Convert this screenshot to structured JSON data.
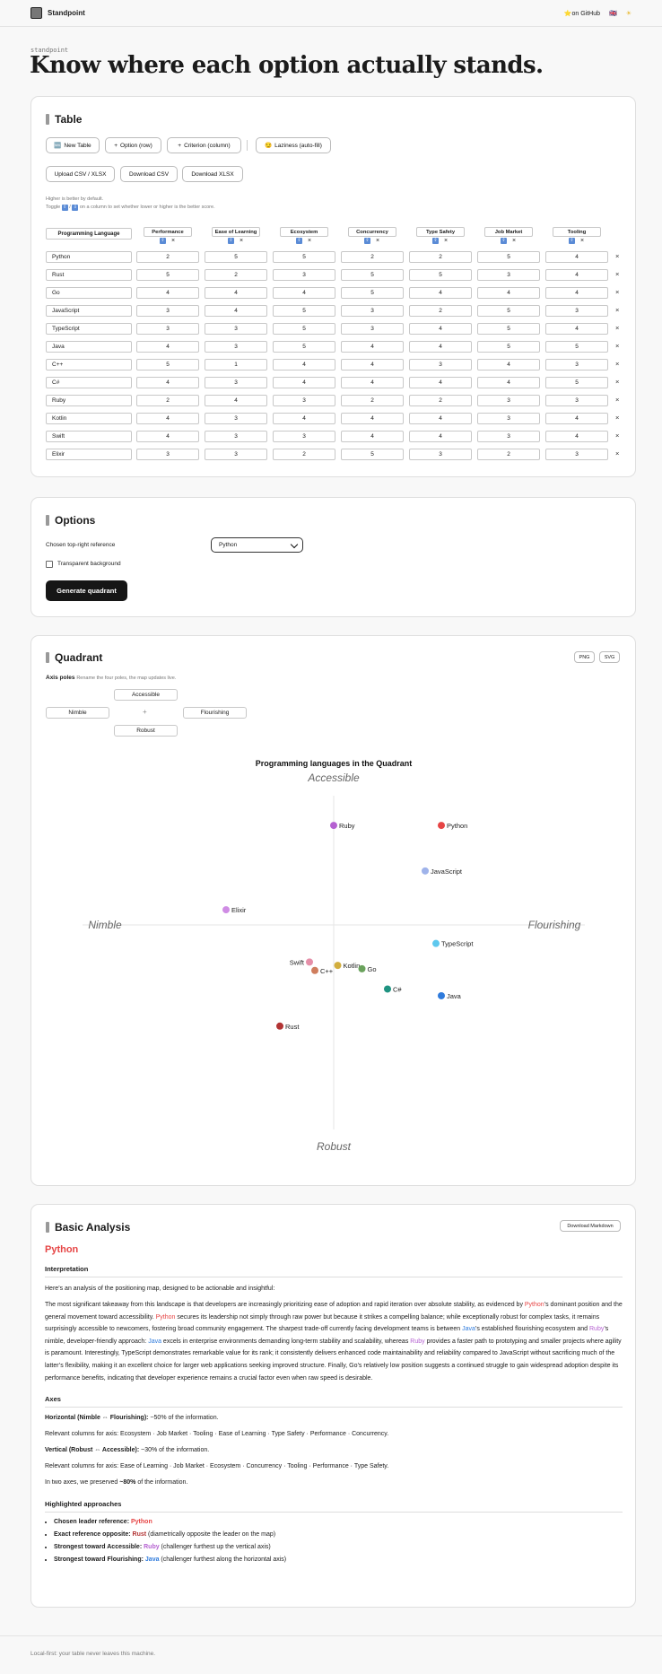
{
  "app": {
    "brand": "Standpoint",
    "github": "on GitHub",
    "flag": "🇬🇧",
    "theme_icon": "☀"
  },
  "eyebrow": "standpoint",
  "hero": "Know where each option actually stands.",
  "table_card": {
    "title": "Table",
    "buttons": {
      "new_table": "New Table",
      "option_row": "Option (row)",
      "criterion_col": "Criterion (column)",
      "laziness": "Laziness (auto-fill)",
      "upload": "Upload CSV / XLSX",
      "download_csv": "Download CSV",
      "download_xlsx": "Download XLSX"
    },
    "hint1": "Higher is better by default.",
    "hint2": "on a column to set whether lower or higher is the better score.",
    "hint2_prefix": "Toggle",
    "row_header": "Programming Language",
    "columns": [
      "Performance",
      "Ease of Learning",
      "Ecosystem",
      "Concurrency",
      "Type Safety",
      "Job Market",
      "Tooling"
    ],
    "rows": [
      {
        "name": "Python",
        "values": [
          "2",
          "5",
          "5",
          "2",
          "2",
          "5",
          "4"
        ]
      },
      {
        "name": "Rust",
        "values": [
          "5",
          "2",
          "3",
          "5",
          "5",
          "3",
          "4"
        ]
      },
      {
        "name": "Go",
        "values": [
          "4",
          "4",
          "4",
          "5",
          "4",
          "4",
          "4"
        ]
      },
      {
        "name": "JavaScript",
        "values": [
          "3",
          "4",
          "5",
          "3",
          "2",
          "5",
          "3"
        ]
      },
      {
        "name": "TypeScript",
        "values": [
          "3",
          "3",
          "5",
          "3",
          "4",
          "5",
          "4"
        ]
      },
      {
        "name": "Java",
        "values": [
          "4",
          "3",
          "5",
          "4",
          "4",
          "5",
          "5"
        ]
      },
      {
        "name": "C++",
        "values": [
          "5",
          "1",
          "4",
          "4",
          "3",
          "4",
          "3"
        ]
      },
      {
        "name": "C#",
        "values": [
          "4",
          "3",
          "4",
          "4",
          "4",
          "4",
          "5"
        ]
      },
      {
        "name": "Ruby",
        "values": [
          "2",
          "4",
          "3",
          "2",
          "2",
          "3",
          "3"
        ]
      },
      {
        "name": "Kotlin",
        "values": [
          "4",
          "3",
          "4",
          "4",
          "4",
          "3",
          "4"
        ]
      },
      {
        "name": "Swift",
        "values": [
          "4",
          "3",
          "3",
          "4",
          "4",
          "3",
          "4"
        ]
      },
      {
        "name": "Elixir",
        "values": [
          "3",
          "3",
          "2",
          "5",
          "3",
          "2",
          "3"
        ]
      }
    ]
  },
  "options_card": {
    "title": "Options",
    "reference_label": "Chosen top-right reference",
    "reference_value": "Python",
    "transparent_label": "Transparent background",
    "generate": "Generate quadrant"
  },
  "quadrant_card": {
    "title": "Quadrant",
    "png": "PNG",
    "svg": "SVG",
    "axis_poles_label": "Axis poles",
    "axis_poles_hint": "Rename the four poles, the map updates live.",
    "poles": {
      "top": "Accessible",
      "left": "Nimble",
      "right": "Flourishing",
      "bottom": "Robust",
      "center": "+"
    },
    "chart_title": "Programming languages in the Quadrant"
  },
  "chart_data": {
    "type": "scatter",
    "title": "Programming languages in the Quadrant",
    "xlabel_left": "Nimble",
    "xlabel_right": "Flourishing",
    "ylabel_top": "Accessible",
    "ylabel_bottom": "Robust",
    "xlim": [
      -1,
      1
    ],
    "ylim": [
      -1,
      1
    ],
    "grid": false,
    "points": [
      {
        "label": "Ruby",
        "x": 0.0,
        "y": 0.59,
        "color": "#b561d1"
      },
      {
        "label": "Python",
        "x": 0.8,
        "y": 0.59,
        "color": "#e64545"
      },
      {
        "label": "JavaScript",
        "x": 0.68,
        "y": 0.32,
        "color": "#9fb3ea"
      },
      {
        "label": "Elixir",
        "x": -0.8,
        "y": 0.09,
        "color": "#cf8ce4"
      },
      {
        "label": "TypeScript",
        "x": 0.76,
        "y": -0.11,
        "color": "#5ec8ee"
      },
      {
        "label": "Swift",
        "x": -0.18,
        "y": -0.22,
        "color": "#e58fa8"
      },
      {
        "label": "Kotlin",
        "x": 0.03,
        "y": -0.24,
        "color": "#d2ae3e"
      },
      {
        "label": "C++",
        "x": -0.14,
        "y": -0.27,
        "color": "#cf7d5d"
      },
      {
        "label": "Go",
        "x": 0.21,
        "y": -0.26,
        "color": "#6aa25c"
      },
      {
        "label": "C#",
        "x": 0.4,
        "y": -0.38,
        "color": "#1f9381"
      },
      {
        "label": "Java",
        "x": 0.8,
        "y": -0.42,
        "color": "#2f7bdc"
      },
      {
        "label": "Rust",
        "x": -0.4,
        "y": -0.6,
        "color": "#b23434"
      }
    ]
  },
  "analysis_card": {
    "title": "Basic Analysis",
    "download": "Download Markdown",
    "reference": "Python",
    "interp_heading": "Interpretation",
    "intro": "Here’s an analysis of the positioning map, designed to be actionable and insightful:",
    "p_parts": [
      "The most significant takeaway from this landscape is that developers are increasingly prioritizing ease of adoption and rapid iteration over absolute stability, as evidenced by ",
      "’s dominant position and the general movement toward accessibility. ",
      " secures its leadership not simply through raw power but because it strikes a compelling balance; while exceptionally robust for complex tasks, it remains surprisingly accessible to newcomers, fostering broad community engagement. The sharpest trade-off currently facing development teams is between ",
      "’s established flourishing ecosystem and ",
      "’s nimble, developer-friendly approach: ",
      " excels in enterprise environments demanding long-term stability and scalability, whereas ",
      " provides a faster path to prototyping and smaller projects where agility is paramount. Interestingly, TypeScript demonstrates remarkable value for its rank; it consistently delivers enhanced code maintainability and reliability compared to JavaScript without sacrificing much of the latter’s flexibility, making it an excellent choice for larger web applications seeking improved structure. Finally, Go’s relatively low position suggests a continued struggle to gain widespread adoption despite its performance benefits, indicating that developer experience remains a crucial factor even when raw speed is desirable."
    ],
    "names": {
      "python": "Python",
      "java": "Java",
      "ruby": "Ruby",
      "rust": "Rust"
    },
    "axes_heading": "Axes",
    "h_axis": "Horizontal (Nimble ⇔ Flourishing):",
    "h_pct": "~50% of the information.",
    "h_cols": "Relevant columns for axis: Ecosystem · Job Market · Tooling · Ease of Learning · Type Safety · Performance · Concurrency.",
    "v_axis": "Vertical (Robust ⇔ Accessible):",
    "v_pct": "~30% of the information.",
    "v_cols": "Relevant columns for axis: Ease of Learning · Job Market · Ecosystem · Concurrency · Tooling · Performance · Type Safety.",
    "preserved_pre": "In two axes, we preserved ",
    "preserved_val": "~80%",
    "preserved_post": " of the information.",
    "hl_heading": "Highlighted approaches",
    "hl": [
      {
        "label": "Chosen leader reference:",
        "name": "Python",
        "rest": ""
      },
      {
        "label": "Exact reference opposite:",
        "name": "Rust",
        "rest": " (diametrically opposite the leader on the map)"
      },
      {
        "label": "Strongest toward Accessible:",
        "name": "Ruby",
        "rest": " (challenger furthest up the vertical axis)"
      },
      {
        "label": "Strongest toward Flourishing:",
        "name": "Java",
        "rest": " (challenger furthest along the horizontal axis)"
      }
    ]
  },
  "footer": "Local-first: your table never leaves this machine.",
  "colors": {
    "python": "#e64545",
    "rust": "#b23434",
    "ruby": "#b561d1",
    "java": "#2f7bdc"
  }
}
